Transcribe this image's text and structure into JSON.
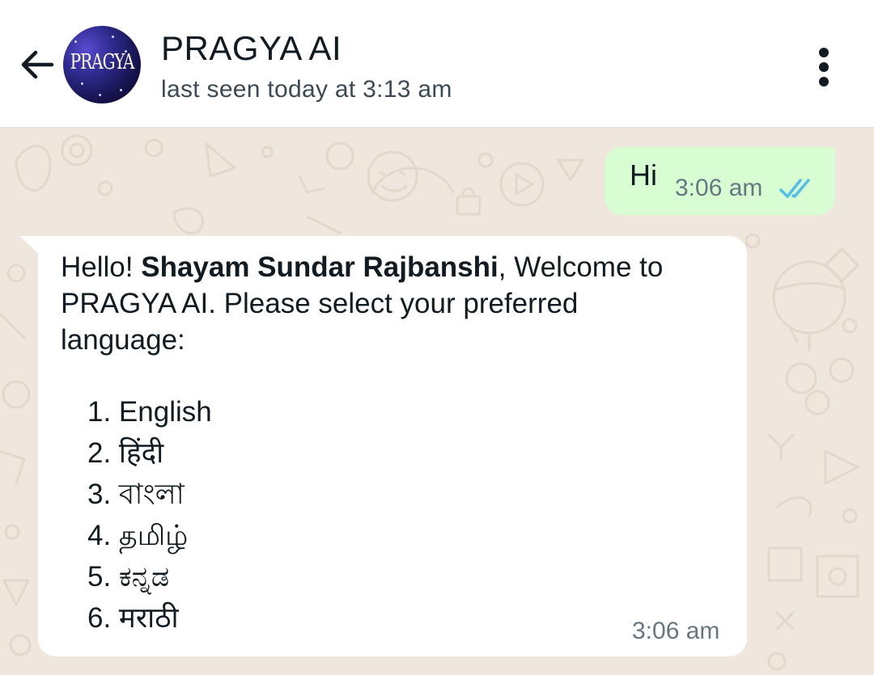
{
  "header": {
    "back_icon": "arrow-left-icon",
    "avatar_text": "PRAGYA",
    "title": "PRAGYA AI",
    "status": "last seen today at 3:13 am",
    "menu_icon": "more-vertical-icon"
  },
  "messages": {
    "outgoing": {
      "text": "Hi",
      "time": "3:06 am",
      "status_icon": "double-check-read-icon",
      "status_color": "#53bdeb"
    },
    "incoming": {
      "greeting_prefix": "Hello! ",
      "user_name": "Shayam Sundar Rajbanshi",
      "greeting_suffix": ", Welcome to PRAGYA AI. Please select your preferred language:",
      "languages": [
        "1. English",
        "2. हिंदी",
        "3. বাংলা",
        "4. தமிழ்",
        "5. ಕನ್ನಡ",
        "6. मराठी"
      ],
      "time": "3:06 am"
    }
  },
  "colors": {
    "chat_background": "#efe7dd",
    "outgoing_bubble": "#d9fdd3",
    "incoming_bubble": "#ffffff"
  }
}
